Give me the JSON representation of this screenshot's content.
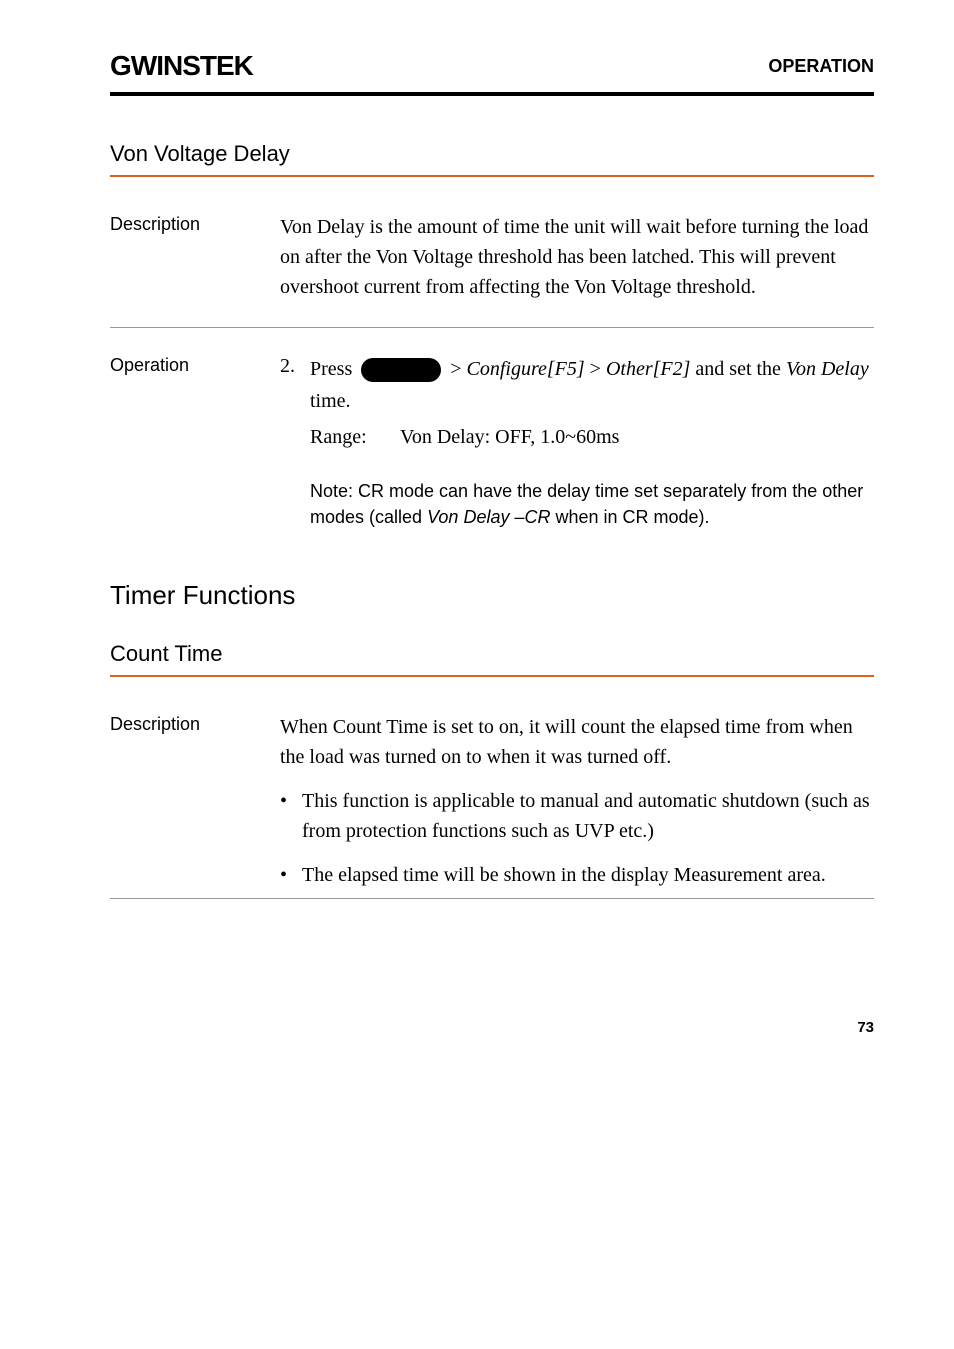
{
  "header": {
    "logo": "GWINSTEK",
    "label": "OPERATION"
  },
  "section1": {
    "heading": "Von Voltage Delay",
    "description": {
      "label": "Description",
      "text": "Von Delay is the amount of time the unit will wait before turning the load on after the Von Voltage threshold has been latched. This will prevent overshoot current from affecting the Von Voltage threshold."
    },
    "operation": {
      "label": "Operation",
      "number": "2.",
      "press": "Press",
      "path_part1": "Configure[F5]",
      "path_part2": "Other[F2]",
      "path_suffix": "and set the",
      "von_delay": "Von Delay",
      "path_end": "time.",
      "range_label": "Range:",
      "range_value": "Von Delay:  OFF, 1.0~60ms",
      "note_prefix": "Note: CR mode can have the delay time set separately from the other modes (called",
      "note_italic": "Von Delay –CR",
      "note_suffix": "when in CR mode)."
    }
  },
  "section2": {
    "big_heading": "Timer Functions",
    "heading": "Count Time",
    "description": {
      "label": "Description",
      "text": "When Count Time is set to on, it will count the elapsed time from when the load was turned on to when it was turned off."
    },
    "bullets": [
      "This function is applicable to manual and automatic shutdown (such as from protection functions such as UVP etc.)",
      "The elapsed time will be shown in the display Measurement area."
    ]
  },
  "page_number": "73"
}
